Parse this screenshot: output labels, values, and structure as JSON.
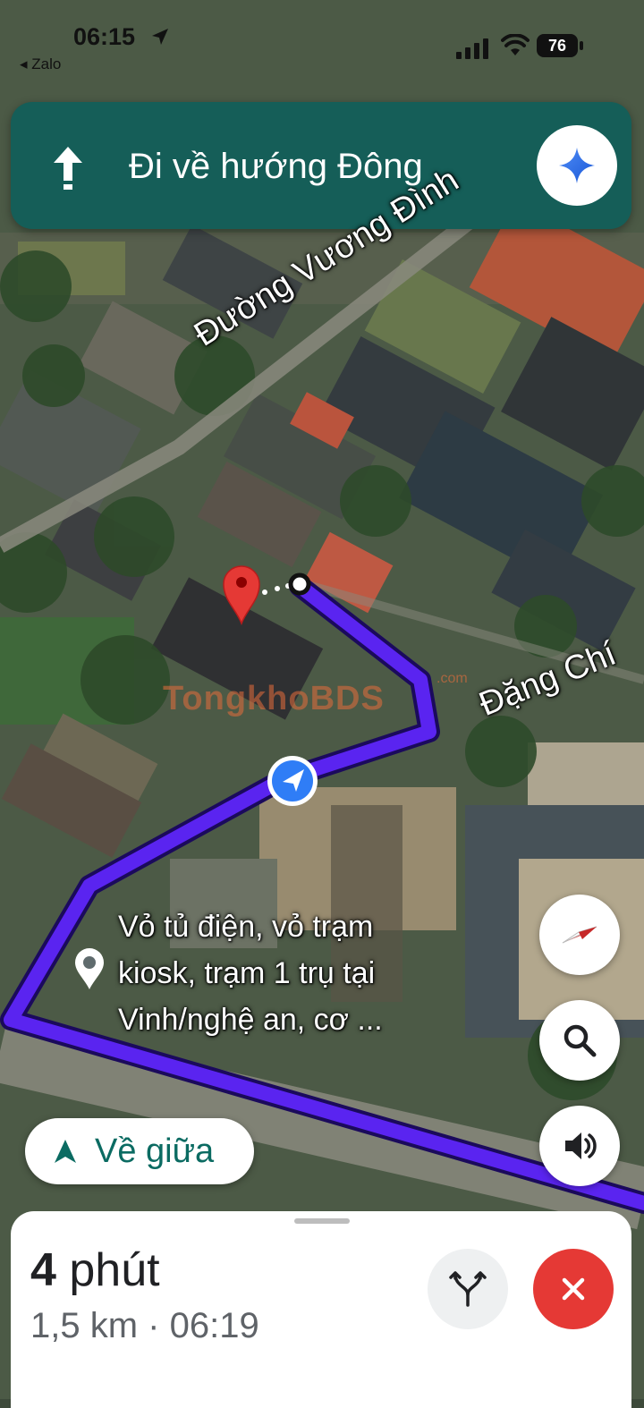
{
  "status_bar": {
    "time": "06:15",
    "back_app": "◂ Zalo",
    "battery": "76"
  },
  "navigation": {
    "instruction": "Đi về hướng Đông",
    "direction_icon": "arrow-up-icon",
    "assistant_icon": "sparkle-icon"
  },
  "map": {
    "streets": [
      "Đường Vương Đình",
      "Đặng Chí"
    ],
    "watermark": "TongkhoBDS",
    "watermark_domain": ".com",
    "destination_label": [
      "Vỏ tủ điện, vỏ trạm",
      "kiosk, trạm 1 trụ tại",
      "Vinh/nghệ an, cơ ..."
    ],
    "route_color": "#5a24f0",
    "destination_pin_color": "#e53935"
  },
  "controls": {
    "recenter_label": "Về giữa",
    "compass_icon": "compass-icon",
    "search_icon": "search-icon",
    "sound_icon": "volume-icon"
  },
  "trip": {
    "duration_value": "4",
    "duration_unit": " phút",
    "distance_eta": "1,5 km · 06:19",
    "alt_routes_icon": "alt-routes-icon",
    "exit_icon": "close-icon",
    "exit_color": "#e53935"
  }
}
